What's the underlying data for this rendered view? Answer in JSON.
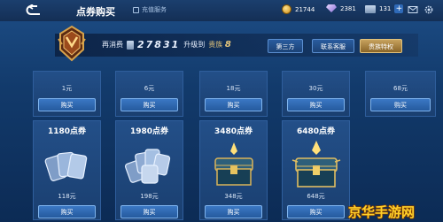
{
  "header": {
    "title": "点券购买",
    "tab2": "充值服务"
  },
  "currencies": [
    {
      "icon": "coin-icon",
      "value": "21744"
    },
    {
      "icon": "gem-icon",
      "value": "2381"
    },
    {
      "icon": "ticket-icon",
      "value": "131"
    }
  ],
  "vip": {
    "prefix": "再消费",
    "amount": "27831",
    "mid": "升级到",
    "level_text": "贵族",
    "level_num": "8"
  },
  "buttons": {
    "third_party": "第三方",
    "contact": "联系客服",
    "vip_privilege": "贵族特权"
  },
  "row1": [
    {
      "price": "1元",
      "buy": "购买"
    },
    {
      "price": "6元",
      "buy": "购买"
    },
    {
      "price": "18元",
      "buy": "购买"
    },
    {
      "price": "30元",
      "buy": "购买"
    },
    {
      "price": "68元",
      "buy": "购买"
    }
  ],
  "row2": [
    {
      "amount": "1180点券",
      "price": "118元",
      "buy": "购买",
      "item": "ticket-stack-icon"
    },
    {
      "amount": "1980点券",
      "price": "198元",
      "buy": "购买",
      "item": "ticket-stack-icon"
    },
    {
      "amount": "3480点券",
      "price": "348元",
      "buy": "购买",
      "item": "treasure-chest-icon"
    },
    {
      "amount": "6480点券",
      "price": "648元",
      "buy": "购买",
      "item": "treasure-chest-icon"
    }
  ],
  "watermark": "京华手游网",
  "colors": {
    "background": "#123a6b",
    "gold": "#e6c77b",
    "button": "#2f6ab8"
  }
}
